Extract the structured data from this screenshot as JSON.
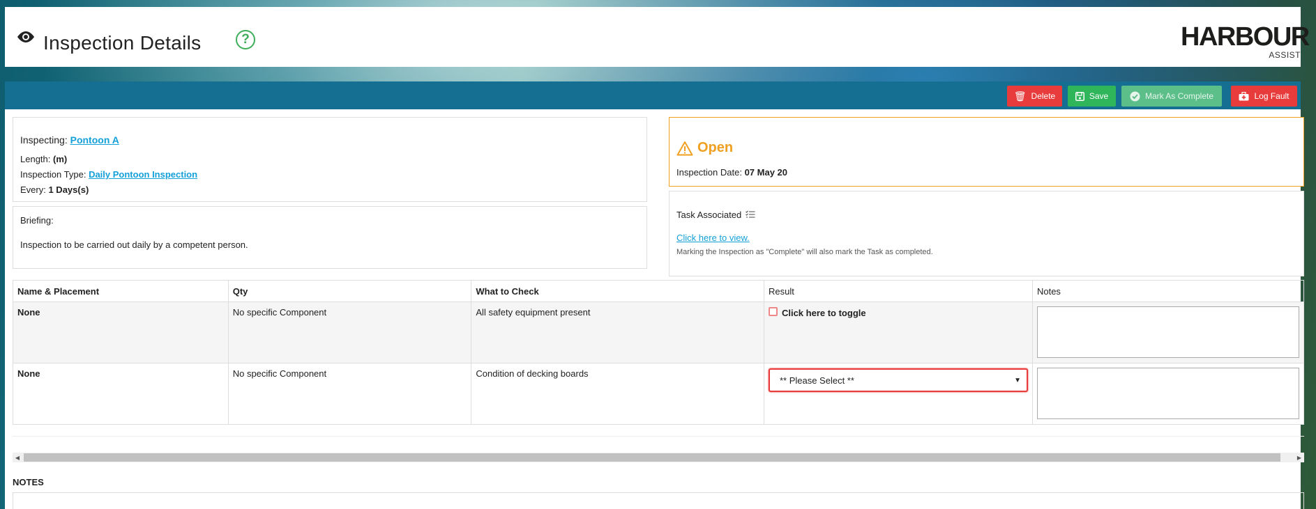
{
  "header": {
    "title": "Inspection Details",
    "help_icon": "?",
    "logo_main": "HARBOUR",
    "logo_sub": "ASSIST"
  },
  "toolbar": {
    "delete_label": "Delete",
    "save_label": "Save",
    "complete_label": "Mark As Complete",
    "fault_label": "Log Fault"
  },
  "inspection": {
    "inspecting_label": "Inspecting:",
    "inspecting_value": "Pontoon A",
    "length_label": "Length:",
    "length_value": "(m)",
    "type_label": "Inspection Type:",
    "type_value": "Daily Pontoon Inspection",
    "every_label": "Every:",
    "every_value": "1 Days(s)"
  },
  "briefing": {
    "label": "Briefing:",
    "text": "Inspection to be carried out daily by a competent person."
  },
  "status": {
    "state": "Open",
    "date_label": "Inspection Date:",
    "date_value": "07 May 20",
    "state_color": "#f0a020"
  },
  "task": {
    "title": "Task Associated",
    "link": "Click here to view.",
    "note": "Marking the Inspection as \"Complete\" will also mark the Task as completed."
  },
  "table": {
    "headers": [
      "Name & Placement",
      "Qty",
      "What to Check",
      "Result",
      "Notes"
    ],
    "rows": [
      {
        "name": "None",
        "qty": "No specific Component",
        "check": "All safety equipment present",
        "result": "Click here to toggle"
      },
      {
        "name": "None",
        "qty": "No specific Component",
        "check": "Condition of decking boards",
        "result": "** Please Select **"
      }
    ]
  },
  "notes_section": {
    "label": "NOTES"
  },
  "icons": {
    "header": "eye-icon",
    "help": "help-circle-icon",
    "delete": "trash-icon",
    "save": "floppy-disk-icon",
    "complete": "check-circle-icon",
    "fault": "medical-bag-icon",
    "status": "warning-triangle-icon",
    "task": "checklist-icon"
  },
  "colors": {
    "toolbar": "#146f92",
    "danger": "#e83b3b",
    "success": "#2fb55a",
    "link": "#14a0d9",
    "help": "#3fae5a"
  }
}
